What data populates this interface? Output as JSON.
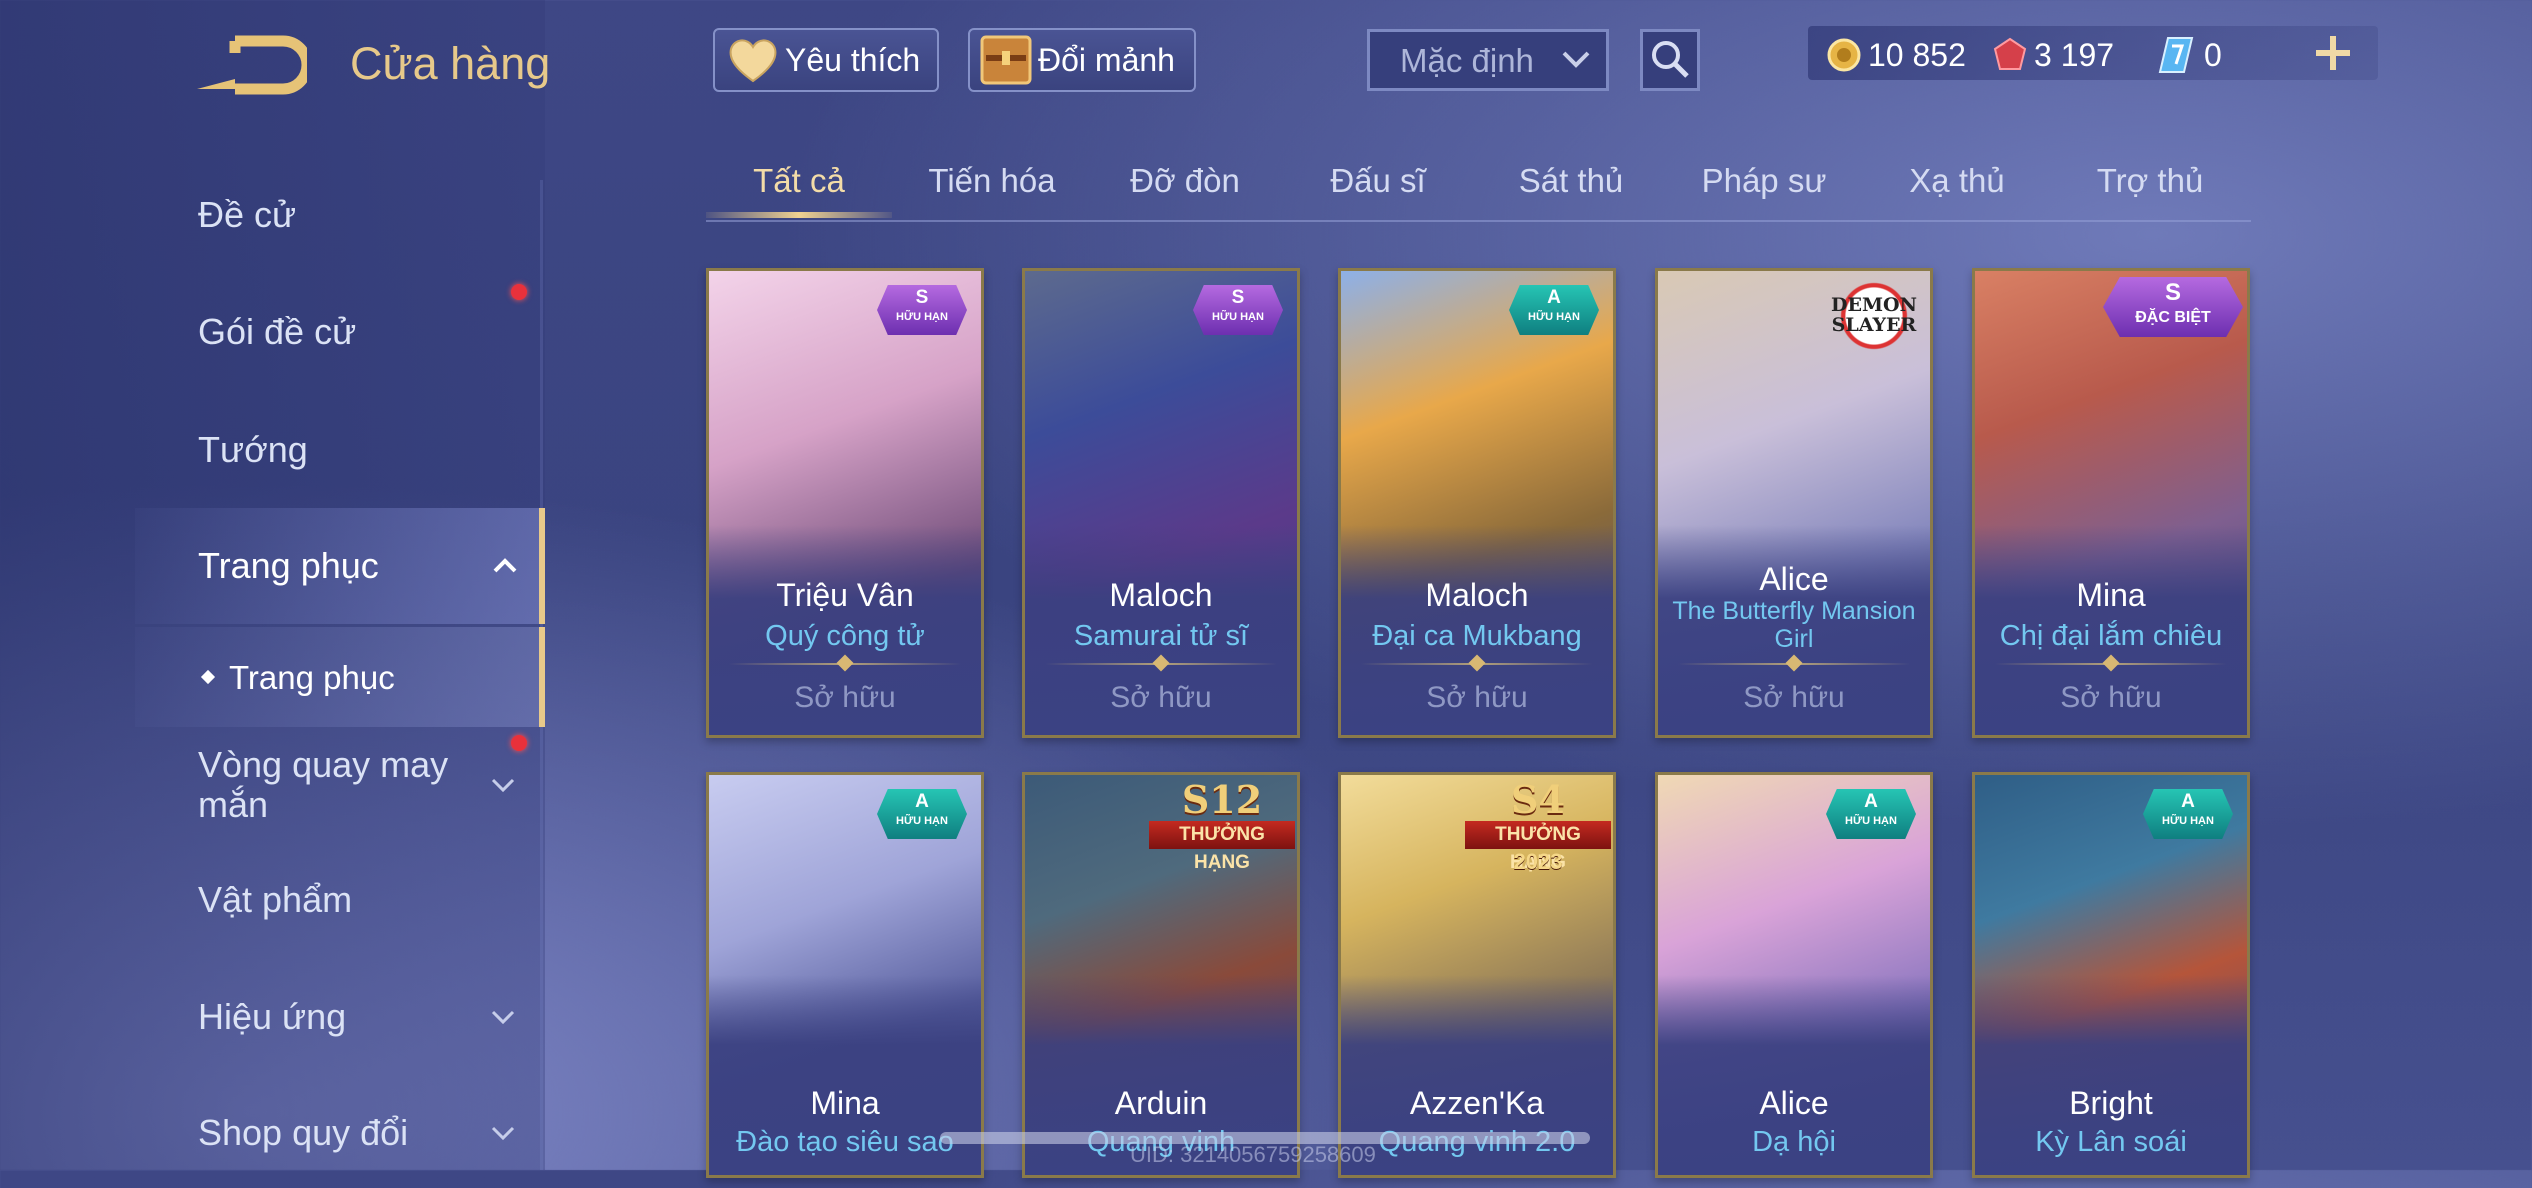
{
  "header": {
    "title": "Cửa hàng",
    "favorite_label": "Yêu thích",
    "exchange_label": "Đổi mảnh",
    "sort_selected": "Mặc định"
  },
  "currencies": [
    {
      "icon": "gold-coin-icon",
      "value": "10 852"
    },
    {
      "icon": "red-gem-icon",
      "value": "3 197"
    },
    {
      "icon": "blue-voucher-icon",
      "value": "0"
    }
  ],
  "sidebar": {
    "items": [
      {
        "label": "Đề cử"
      },
      {
        "label": "Gói đề cử"
      },
      {
        "label": "Tướng"
      },
      {
        "label": "Trang phục"
      },
      {
        "label": "Vòng quay may mắn"
      },
      {
        "label": "Vật phẩm"
      },
      {
        "label": "Hiệu ứng"
      },
      {
        "label": "Shop quy đổi"
      }
    ],
    "sub_items": [
      {
        "label": "Trang phục"
      }
    ]
  },
  "tabs": [
    "Tất cả",
    "Tiến hóa",
    "Đỡ đòn",
    "Đấu sĩ",
    "Sát thủ",
    "Pháp sư",
    "Xạ thủ",
    "Trợ thủ"
  ],
  "cards": [
    {
      "hero": "Triệu Vân",
      "skin": "Quý công tử",
      "status": "Sở hữu",
      "badge": {
        "tier": "S",
        "label": "HỮU HẠN"
      }
    },
    {
      "hero": "Maloch",
      "skin": "Samurai tử sĩ",
      "status": "Sở hữu",
      "badge": {
        "tier": "S",
        "label": "HỮU HẠN"
      }
    },
    {
      "hero": "Maloch",
      "skin": "Đại ca Mukbang",
      "status": "Sở hữu",
      "badge": {
        "tier": "A",
        "label": "HỮU HẠN"
      }
    },
    {
      "hero": "Alice",
      "skin": "The Butterfly Mansion Girl",
      "status": "Sở hữu",
      "badge": {
        "top": "DEMON",
        "bottom": "SLAYER"
      }
    },
    {
      "hero": "Mina",
      "skin": "Chị đại lắm chiêu",
      "status": "Sở hữu",
      "badge": {
        "tier": "S",
        "label": "ĐẶC BIỆT"
      }
    },
    {
      "hero": "Mina",
      "skin": "Đào tạo siêu sao",
      "badge": {
        "tier": "A",
        "label": "HỮU HẠN"
      }
    },
    {
      "hero": "Arduin",
      "skin": "Quang vinh",
      "badge": {
        "season": "S12",
        "label": "THƯỞNG HẠNG"
      }
    },
    {
      "hero": "Azzen'Ka",
      "skin": "Quang vinh 2.0",
      "badge": {
        "season": "S4",
        "label": "THƯỞNG HẠNG",
        "year": "2023"
      }
    },
    {
      "hero": "Alice",
      "skin": "Dạ hội",
      "badge": {
        "tier": "A",
        "label": "HỮU HẠN"
      }
    },
    {
      "hero": "Bright",
      "skin": "Kỳ Lân soái",
      "badge": {
        "tier": "A",
        "label": "HỮU HẠN"
      }
    }
  ],
  "footer": {
    "uid": "UID: 3214056759258609"
  },
  "colors": {
    "accent_gold": "#e7c98a",
    "skin_name": "#73c8f0",
    "notification_dot": "#e8313b",
    "badge_s": "#8a45c8",
    "badge_a": "#1aa39a"
  }
}
